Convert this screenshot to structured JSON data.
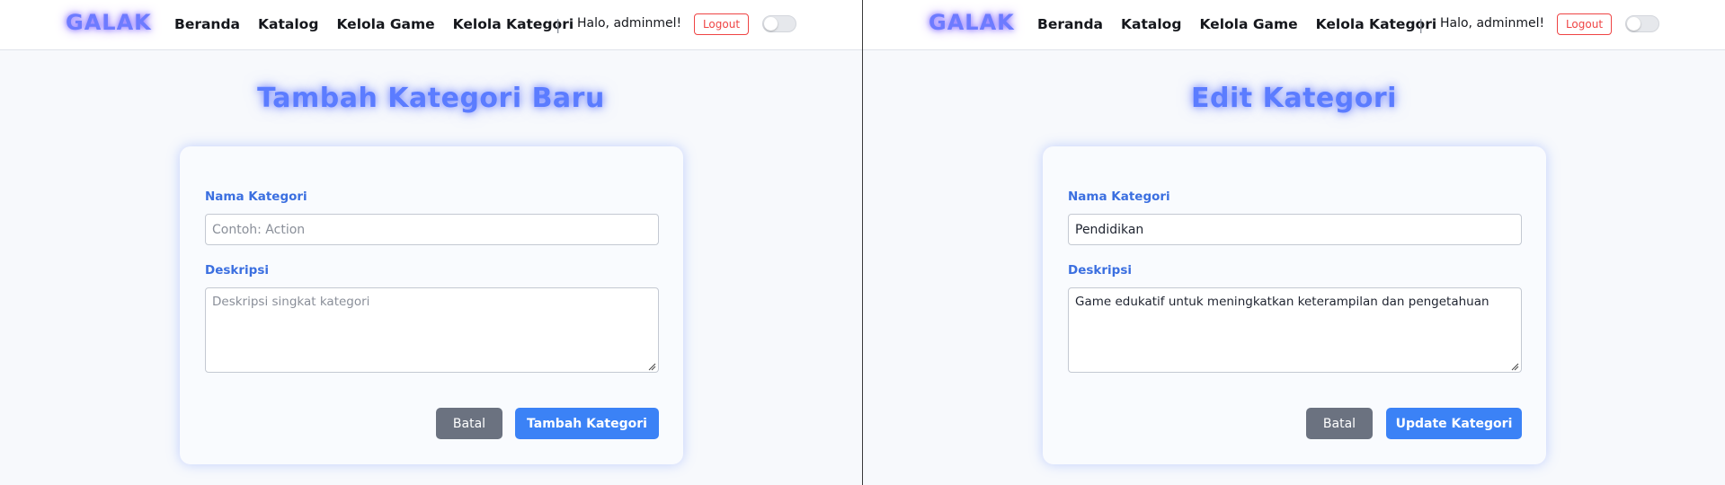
{
  "screens": [
    {
      "nav": {
        "logo": "GALAK",
        "links": [
          "Beranda",
          "Katalog",
          "Kelola Game",
          "Kelola Kategori"
        ],
        "separator": "|",
        "greeting": "Halo, adminmel!",
        "logout_label": "Logout"
      },
      "title": "Tambah Kategori Baru",
      "form": {
        "name_label": "Nama Kategori",
        "name_value": "",
        "name_placeholder": "Contoh: Action",
        "desc_label": "Deskripsi",
        "desc_value": "",
        "desc_placeholder": "Deskripsi singkat kategori",
        "cancel_label": "Batal",
        "submit_label": "Tambah Kategori"
      }
    },
    {
      "nav": {
        "logo": "GALAK",
        "links": [
          "Beranda",
          "Katalog",
          "Kelola Game",
          "Kelola Kategori"
        ],
        "separator": "|",
        "greeting": "Halo, adminmel!",
        "logout_label": "Logout"
      },
      "title": "Edit Kategori",
      "form": {
        "name_label": "Nama Kategori",
        "name_value": "Pendidikan",
        "name_placeholder": "",
        "desc_label": "Deskripsi",
        "desc_value": "Game edukatif untuk meningkatkan keterampilan dan pengetahuan",
        "desc_placeholder": "",
        "cancel_label": "Batal",
        "submit_label": "Update Kategori"
      }
    }
  ],
  "colors": {
    "accent": "#3b82f6",
    "title_glow": "#5b7cff",
    "logo": "#6d7bff",
    "logout": "#ef4444",
    "cancel": "#6b7280",
    "label": "#3b6fe0"
  },
  "icons": {
    "theme_toggle": "toggle-switch-icon",
    "textarea_grip": "resize-grip-icon"
  }
}
